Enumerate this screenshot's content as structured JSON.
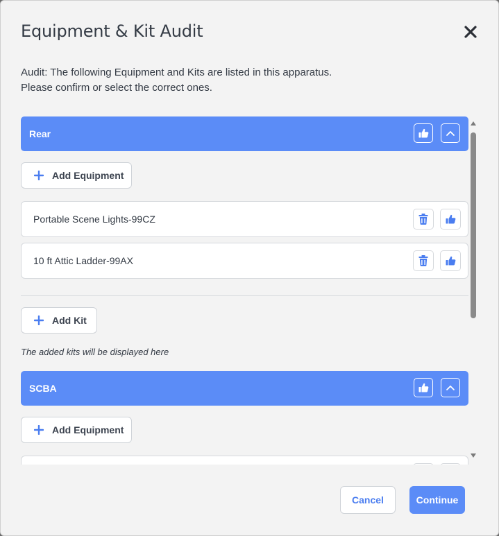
{
  "modal": {
    "title": "Equipment & Kit Audit",
    "close_icon": "close-icon",
    "description_line1": "Audit: The following Equipment and Kits are listed in this apparatus.",
    "description_line2": "Please confirm or select the correct ones."
  },
  "sections": [
    {
      "label": "Rear",
      "add_equipment_label": "Add Equipment",
      "equipment": [
        {
          "name": "Portable Scene Lights-99CZ"
        },
        {
          "name": "10 ft Attic Ladder-99AX"
        }
      ],
      "add_kit_label": "Add Kit",
      "kits_hint": "The added kits will be displayed here"
    },
    {
      "label": "SCBA",
      "add_equipment_label": "Add Equipment"
    }
  ],
  "footer": {
    "cancel_label": "Cancel",
    "continue_label": "Continue"
  },
  "colors": {
    "accent": "#5b8cf7",
    "background": "#f3f3f3",
    "text": "#333a44"
  }
}
